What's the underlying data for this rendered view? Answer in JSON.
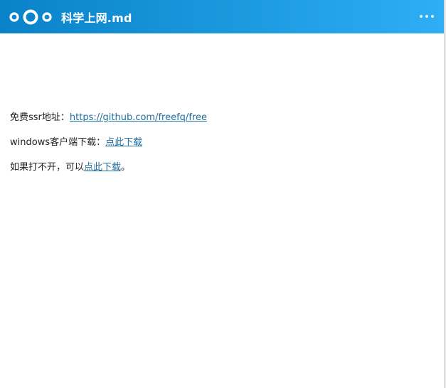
{
  "header": {
    "title": "科学上网.md",
    "more_icon": "ellipsis-icon",
    "logo_icon": "nextcloud-logo",
    "accent_start": "#0a82c9",
    "accent_end": "#2eaef5"
  },
  "content": {
    "line1": {
      "prefix": "免费ssr地址：",
      "link_text": "https://github.com/freefq/free"
    },
    "line2": {
      "prefix": "windows客户端下载：",
      "link_text": "点此下载"
    },
    "line3": {
      "prefix": "如果打不开，可以",
      "link_text": "点此下载",
      "suffix": "。"
    },
    "link_color": "#1f6f9e"
  }
}
